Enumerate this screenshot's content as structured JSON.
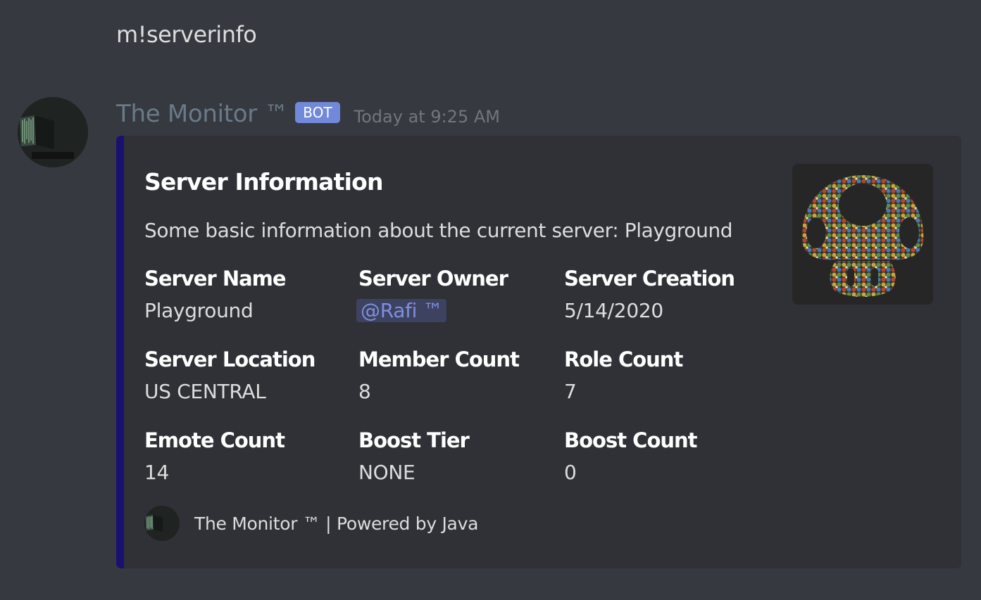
{
  "previous_message": {
    "text": "m!serverinfo"
  },
  "message": {
    "author": "The Monitor ™",
    "bot_tag": "BOT",
    "timestamp": "Today at 9:25 AM",
    "avatar_icon": "dark-computer-screen-avatar-icon"
  },
  "embed": {
    "accent_color": "#1a1070",
    "title": "Server Information",
    "description": "Some basic information about the current server: Playground",
    "thumbnail_icon": "mushroom-mosaic-server-icon",
    "fields": [
      {
        "name": "Server Name",
        "value": "Playground"
      },
      {
        "name": "Server Owner",
        "value": "@Rafi ™"
      },
      {
        "name": "Server Creation",
        "value": "5/14/2020"
      },
      {
        "name": "Server Location",
        "value": "US CENTRAL"
      },
      {
        "name": "Member Count",
        "value": "8"
      },
      {
        "name": "Role Count",
        "value": "7"
      },
      {
        "name": "Emote Count",
        "value": "14"
      },
      {
        "name": "Boost Tier",
        "value": "NONE"
      },
      {
        "name": "Boost Count",
        "value": "0"
      }
    ],
    "footer": {
      "text": "The Monitor ™ | Powered by Java",
      "icon": "dark-computer-screen-avatar-icon"
    }
  },
  "colors": {
    "background": "#36393f",
    "embed_background": "#2f3136",
    "bot_tag": "#7289da",
    "mention_background": "#3e4261",
    "mention_text": "#7f8fdc"
  }
}
